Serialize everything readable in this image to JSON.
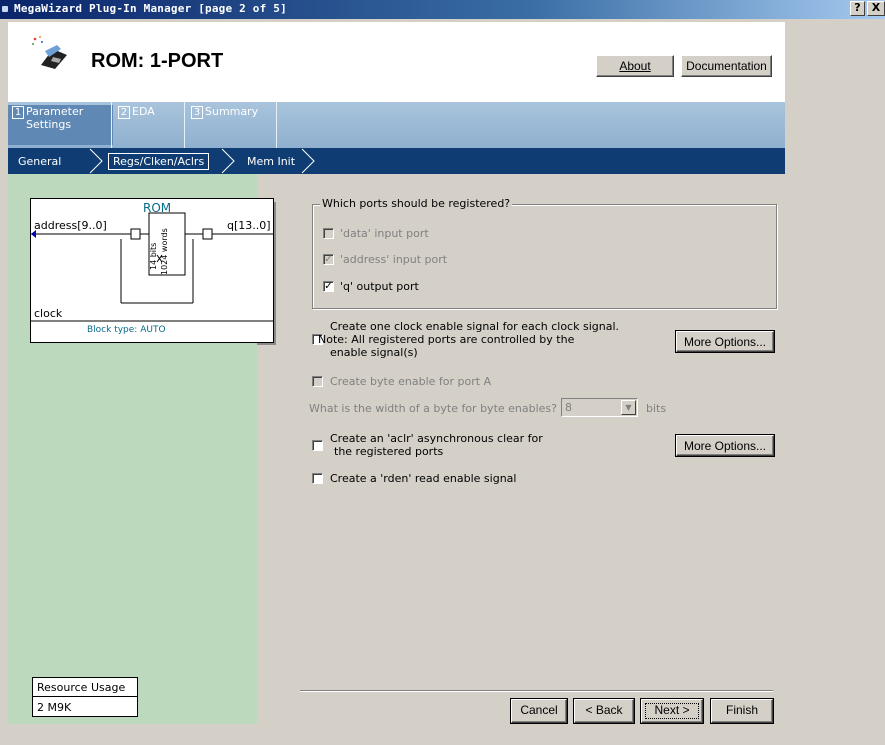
{
  "window": {
    "title": "MegaWizard Plug-In Manager [page 2 of 5]",
    "help_btn": "?",
    "close_btn": "X"
  },
  "header": {
    "title": "ROM: 1-PORT",
    "about_label": "About",
    "documentation_label": "Documentation"
  },
  "steps": [
    {
      "num": "1",
      "label": "Parameter Settings"
    },
    {
      "num": "2",
      "label": "EDA"
    },
    {
      "num": "3",
      "label": "Summary"
    }
  ],
  "breadcrumbs": [
    "General",
    "Regs/Clken/Aclrs",
    "Mem Init"
  ],
  "diagram": {
    "title": "ROM",
    "address": "address[9..0]",
    "q": "q[13..0]",
    "clock": "clock",
    "inner1": "14 bits",
    "inner2": "1024 words",
    "block_type": "Block type: AUTO"
  },
  "resource": {
    "label": "Resource Usage",
    "value": "2 M9K"
  },
  "ports_group": {
    "legend": "Which ports should be registered?",
    "data_port": "'data' input port",
    "address_port": "'address' input port",
    "q_port": "'q' output port"
  },
  "options": {
    "clock_enable": [
      "Create one clock enable signal for each clock signal.",
      "Note: All registered ports are controlled by the",
      "enable signal(s)"
    ],
    "byte_enable": "Create byte enable for port A",
    "byte_width_label": "What is the width of a byte for byte enables?",
    "byte_width_value": "8",
    "byte_width_unit": "bits",
    "aclr": [
      "Create an 'aclr' asynchronous clear for",
      "the registered ports"
    ],
    "rden": "Create a 'rden' read enable signal",
    "more_options_label": "More Options..."
  },
  "footer": {
    "cancel": "Cancel",
    "back": "< Back",
    "next": "Next >",
    "finish": "Finish"
  }
}
